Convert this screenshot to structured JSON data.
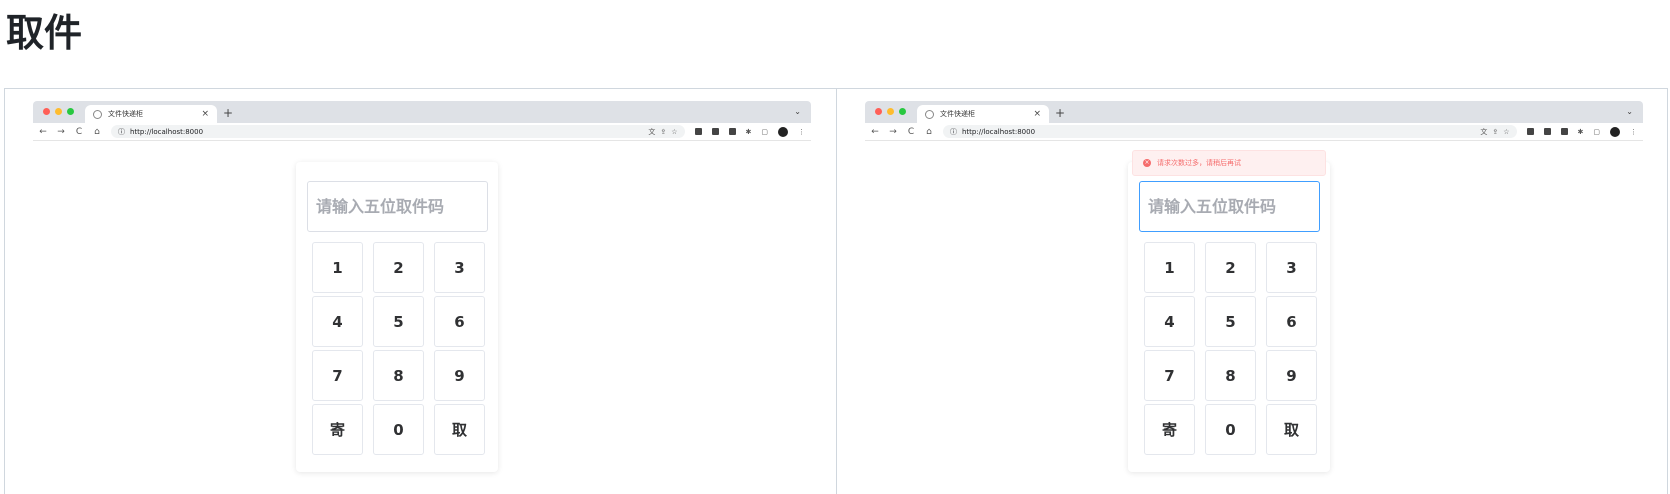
{
  "doc": {
    "title": "取件"
  },
  "colors": {
    "dot_red": "#ff5f57",
    "dot_yellow": "#febc2e",
    "dot_green": "#28c840",
    "error": "#f56c6c",
    "focus": "#409eff"
  },
  "browser": {
    "tab_title": "文件快递柜",
    "tab_close": "×",
    "new_tab": "+",
    "chevron": "⌄",
    "nav": {
      "back": "←",
      "forward": "→",
      "reload": "C",
      "home": "⌂"
    },
    "info_icon": "ⓘ",
    "url": "http://localhost:8000",
    "toolbar_icons": [
      "translate-icon",
      "share-icon",
      "star-icon",
      "extension-icons",
      "puzzle-icon",
      "sidepanel-icon",
      "profile-icon",
      "menu-icon"
    ],
    "menu": "⋮"
  },
  "page": {
    "placeholder": "请输入五位取件码",
    "keys": [
      "1",
      "2",
      "3",
      "4",
      "5",
      "6",
      "7",
      "8",
      "9",
      "寄",
      "0",
      "取"
    ],
    "toast": {
      "icon": "×",
      "text": "请求次数过多，请稍后再试"
    }
  }
}
